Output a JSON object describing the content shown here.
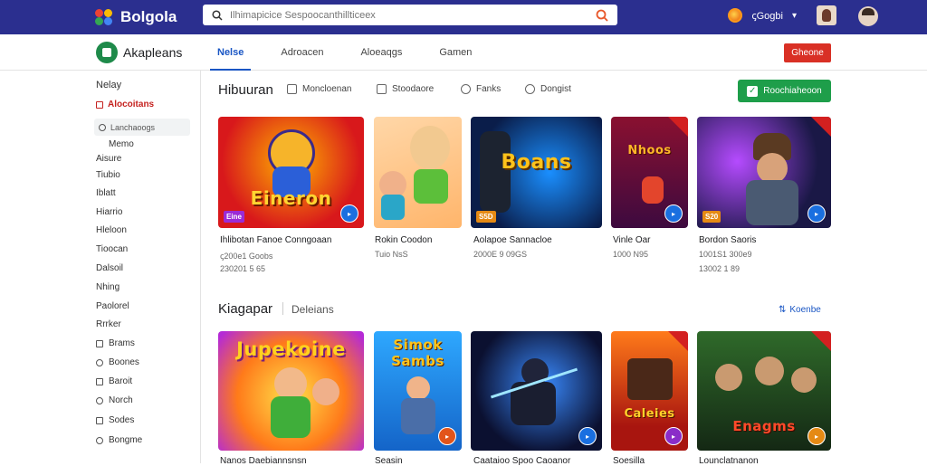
{
  "topbar": {
    "brand": "Bolgola",
    "search_placeholder": "Ilhimapicice Sespoocanthillticeex",
    "user_label": "ꞔGogbi",
    "colors": {
      "bar": "#2b2f8f"
    }
  },
  "appbar": {
    "title": "Akapleans",
    "tabs": [
      {
        "label": "Nelse",
        "active": true
      },
      {
        "label": "Adroacen",
        "active": false
      },
      {
        "label": "Aloeaqgs",
        "active": false
      },
      {
        "label": "Gamen",
        "active": false
      }
    ],
    "action_label": "Gheone"
  },
  "sidebar": {
    "heading": "Nelay",
    "active_item": "Alocoitans",
    "search_placeholder": "Lanchaoogs",
    "items": [
      "Memo",
      "Aisure",
      "Tiubio",
      "Iblatt",
      "Hiarrio",
      "Hleloon",
      "Tioocan",
      "Dalsoil",
      "Nhing",
      "Paolorel",
      "Rrrker",
      "Brams",
      "Boones",
      "Baroit",
      "Norch",
      "Sodes",
      "Bongme"
    ]
  },
  "section1": {
    "title": "Hibuuran",
    "filters": [
      "Moncloenan",
      "Stoodaore",
      "Fanks",
      "Dongist"
    ],
    "button": "Roochiaheoon"
  },
  "section2": {
    "title": "Kiagapar",
    "subtitle": "Deleians",
    "see_all": "Koenbe"
  },
  "games_row1": [
    {
      "art_title": "Eineron",
      "badge": "Eine",
      "title": "Ihlibotan Fanoe Conngoaan",
      "sub1": "ꞔ200e1 Goobs",
      "sub2": "230201 5 65"
    },
    {
      "art_title": "",
      "badge": "",
      "title": "Rokin Coodon",
      "sub1": "Tuio NsS",
      "sub2": ""
    },
    {
      "art_title": "Boans",
      "badge": "S5D",
      "title": "Aolapoe Sannacloe",
      "sub1": "2000E 9 09GS",
      "sub2": ""
    },
    {
      "art_title": "Nhoos",
      "badge": "",
      "title": "Vinle Oar",
      "sub1": "1000 N95",
      "sub2": ""
    },
    {
      "art_title": "",
      "badge": "S20",
      "title": "Bordon Saoris",
      "sub1": "1001S1 300e9",
      "sub2": "13002 1 89"
    }
  ],
  "games_row2": [
    {
      "art_title": "Jupekoine",
      "title": "Nanos Daebiannsnsn"
    },
    {
      "art_title": "Simok Sambs",
      "title": "Seasin"
    },
    {
      "art_title": "",
      "title": "Caataioo Spoo Caoanor"
    },
    {
      "art_title": "Caleies",
      "title": "Soesilla"
    },
    {
      "art_title": "Enagms",
      "title": "Lounclatnanon"
    }
  ]
}
